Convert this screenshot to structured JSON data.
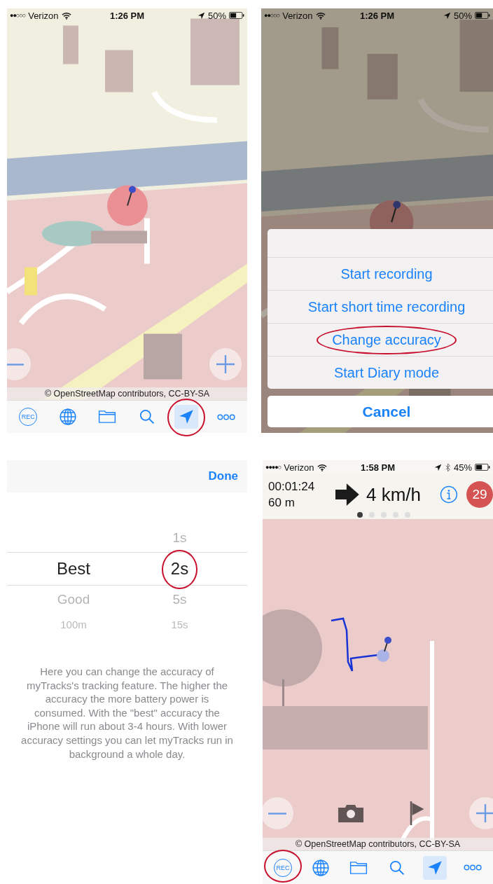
{
  "screens": [
    {
      "kind": "map",
      "status_bar": {
        "signal": "●●○○○",
        "carrier": "Verizon",
        "time": "1:26 PM",
        "battery": "50%"
      },
      "map_controls": [
        {
          "kind": "zoom_out"
        },
        {
          "kind": "zoom_in"
        }
      ],
      "attribution": "© OpenStreetMap contributors, CC-BY-SA",
      "toolbar": [
        {
          "kind": "rec",
          "label": "REC",
          "selected": false,
          "highlighted": false
        },
        {
          "kind": "globe",
          "selected": false,
          "highlighted": false
        },
        {
          "kind": "folder",
          "selected": false,
          "highlighted": false
        },
        {
          "kind": "search",
          "selected": false,
          "highlighted": false
        },
        {
          "kind": "locate",
          "selected": true,
          "highlighted": true
        },
        {
          "kind": "more",
          "selected": false,
          "highlighted": false
        }
      ]
    },
    {
      "kind": "action_sheet",
      "status_bar": {
        "signal": "●●○○○",
        "carrier": "Verizon",
        "time": "1:26 PM",
        "battery": "50%"
      },
      "actions": [
        {
          "label": "Start recording",
          "highlighted": false
        },
        {
          "label": "Start short time recording",
          "highlighted": false
        },
        {
          "label": "Change accuracy",
          "highlighted": true
        },
        {
          "label": "Start Diary mode",
          "highlighted": false
        }
      ],
      "cancel": "Cancel"
    },
    {
      "kind": "picker",
      "done": "Done",
      "columns": [
        {
          "options": [
            {
              "label": "Best",
              "selected": true,
              "highlighted": false
            },
            {
              "label": "Good",
              "selected": false,
              "highlighted": false
            },
            {
              "label": "100m",
              "selected": false,
              "highlighted": false
            }
          ]
        },
        {
          "options": [
            {
              "label": "1s",
              "selected": false,
              "highlighted": false
            },
            {
              "label": "2s",
              "selected": true,
              "highlighted": true
            },
            {
              "label": "5s",
              "selected": false,
              "highlighted": false
            },
            {
              "label": "15s",
              "selected": false,
              "highlighted": false
            }
          ]
        }
      ],
      "description": "Here you can change the accuracy of myTracks's tracking feature. The higher the accuracy the more battery power is consumed. With the \"best\" accuracy the iPhone will run about 3-4 hours. With lower accuracy settings you can let myTracks run in background a whole day."
    },
    {
      "kind": "recording",
      "status_bar": {
        "signal": "●●●●○",
        "carrier": "Verizon",
        "time": "1:58 PM",
        "battery": "45%",
        "bluetooth": true
      },
      "elapsed": "00:01:24",
      "distance": "60 m",
      "speed": "4 km/h",
      "badge": "29",
      "pages": [
        {
          "selected": true
        },
        {
          "selected": false
        },
        {
          "selected": false
        },
        {
          "selected": false
        },
        {
          "selected": false
        }
      ],
      "map_controls": [
        {
          "kind": "zoom_out"
        },
        {
          "kind": "camera"
        },
        {
          "kind": "flag"
        },
        {
          "kind": "zoom_in"
        }
      ],
      "attribution": "© OpenStreetMap contributors, CC-BY-SA",
      "toolbar": [
        {
          "kind": "rec",
          "label": "REC",
          "selected": false,
          "highlighted": true
        },
        {
          "kind": "globe",
          "selected": false,
          "highlighted": false
        },
        {
          "kind": "folder",
          "selected": false,
          "highlighted": false
        },
        {
          "kind": "search",
          "selected": false,
          "highlighted": false
        },
        {
          "kind": "locate",
          "selected": true,
          "highlighted": false
        },
        {
          "kind": "more",
          "selected": false,
          "highlighted": false
        }
      ]
    }
  ]
}
